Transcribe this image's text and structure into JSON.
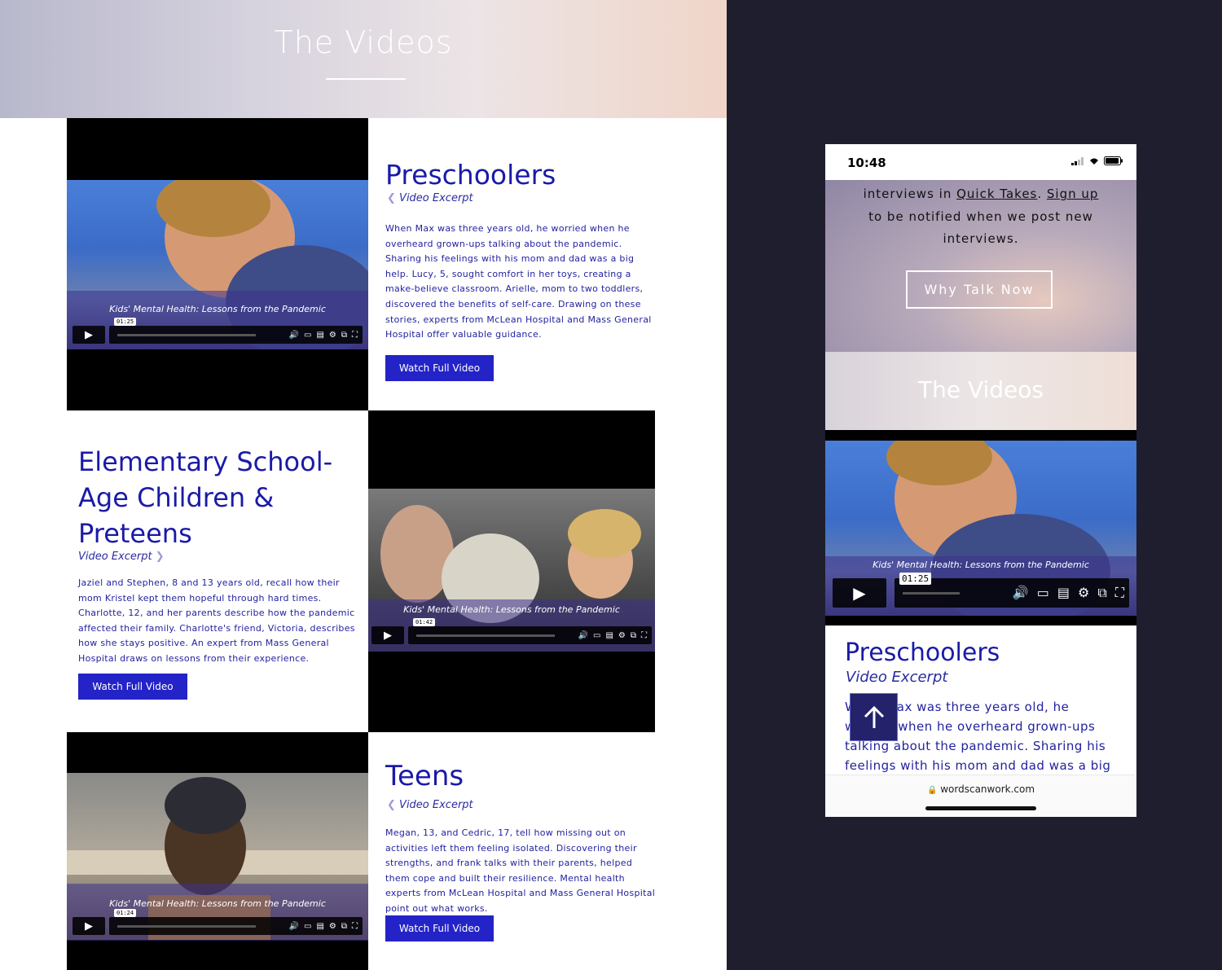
{
  "desktop": {
    "hero_title": "The Videos",
    "sections": [
      {
        "heading": "Preschoolers",
        "excerpt": "Video Excerpt",
        "body": "When Max was three years old, he worried when he overheard grown-ups talking about the pandemic. Sharing his feelings with his mom and dad was a big help. Lucy, 5, sought comfort in her toys, creating a make-believe classroom. Arielle, mom to two toddlers, discovered the benefits of self-care. Drawing on these stories, experts from McLean Hospital and Mass General Hospital offer valuable guidance.",
        "button": "Watch Full Video",
        "video_caption": "Kids' Mental Health: Lessons from the Pandemic",
        "video_subtitle": "Preschoolers",
        "video_time": "01:25"
      },
      {
        "heading": "Elementary School-Age Children & Preteens",
        "excerpt": "Video Excerpt",
        "body": "Jaziel and Stephen, 8 and 13 years old, recall how their mom Kristel kept them hopeful through hard times. Charlotte, 12, and her parents describe how the pandemic affected their family. Charlotte's friend, Victoria, describes how she stays positive. An expert from Mass General Hospital draws on lessons from their experience.",
        "button": "Watch Full Video",
        "video_caption": "Kids' Mental Health: Lessons from the Pandemic",
        "video_subtitle": "Elementary School-Age Children & Preteens",
        "video_time": "01:42"
      },
      {
        "heading": "Teens",
        "excerpt": "Video Excerpt",
        "body": "Megan, 13, and Cedric, 17, tell how missing out on activities left them feeling isolated. Discovering their strengths, and frank talks with their parents, helped them cope and built their resilience. Mental health experts from McLean Hospital and Mass General Hospital point out what works.",
        "button": "Watch Full Video",
        "video_caption": "Kids' Mental Health: Lessons from the Pandemic",
        "video_subtitle": "Teens",
        "video_time": "01:24"
      }
    ]
  },
  "phone": {
    "time": "10:48",
    "intro_prefix": "interviews in ",
    "intro_link1": "Quick Takes",
    "intro_mid": ". ",
    "intro_link2": "Sign up",
    "intro_line2": "to be notified when we post new",
    "intro_line3": "interviews.",
    "why_button": "Why Talk Now",
    "videos_title": "The Videos",
    "video_caption": "Kids' Mental Health: Lessons from the Pandemic",
    "video_time": "01:25",
    "heading": "Preschoolers",
    "excerpt": "Video Excerpt",
    "body": "When Max was three years old, he worried when he overheard grown-ups talking about the pandemic. Sharing his feelings with his mom and dad was a big help. Lucy,",
    "url": "wordscanwork.com"
  },
  "colors": {
    "accent_blue": "#2323c8",
    "heading_blue": "#1a1aa8",
    "dark_bg": "#1f1e2e"
  },
  "icons": [
    "play-icon",
    "volume-icon",
    "captions-icon",
    "transcript-icon",
    "settings-icon",
    "pip-icon",
    "fullscreen-icon",
    "lock-icon",
    "arrow-up-icon",
    "signal-icon",
    "wifi-icon",
    "battery-icon",
    "chevron-left-icon",
    "chevron-right-icon"
  ]
}
